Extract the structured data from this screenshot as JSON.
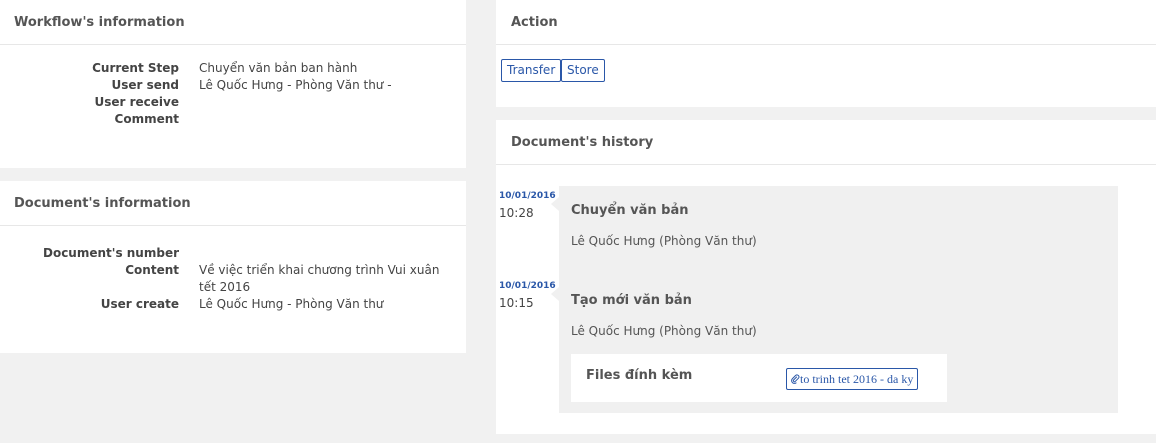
{
  "workflow": {
    "title": "Workflow's information",
    "rows": [
      {
        "label": "Current Step",
        "value": "Chuyển văn bản ban hành"
      },
      {
        "label": "User send",
        "value": "Lê Quốc Hưng - Phòng Văn thư -"
      },
      {
        "label": "User receive",
        "value": ""
      },
      {
        "label": "Comment",
        "value": ""
      }
    ]
  },
  "document": {
    "title": "Document's information",
    "rows": [
      {
        "label": "Document's number",
        "value": ""
      },
      {
        "label": "Content",
        "value": "Về việc triển khai chương trình Vui xuân tết 2016"
      },
      {
        "label": "User create",
        "value": "Lê Quốc Hưng - Phòng Văn thư"
      }
    ]
  },
  "action": {
    "title": "Action",
    "buttons": [
      "Transfer",
      "Store"
    ]
  },
  "history": {
    "title": "Document's history",
    "entries": [
      {
        "date": "10/01/2016",
        "time": "10:28",
        "title": "Chuyển văn bản",
        "user": "Lê Quốc Hưng (Phòng Văn thư)"
      },
      {
        "date": "10/01/2016",
        "time": "10:15",
        "title": "Tạo mới văn bản",
        "user": "Lê Quốc Hưng (Phòng Văn thư)",
        "files_label": "Files đính kèm",
        "file_name": "to trinh tet 2016 - da ky",
        "file_icon": "paperclip-icon"
      }
    ]
  },
  "colors": {
    "accent": "#2a57a8",
    "background": "#f1f1f1",
    "card": "#f0f0f0"
  }
}
